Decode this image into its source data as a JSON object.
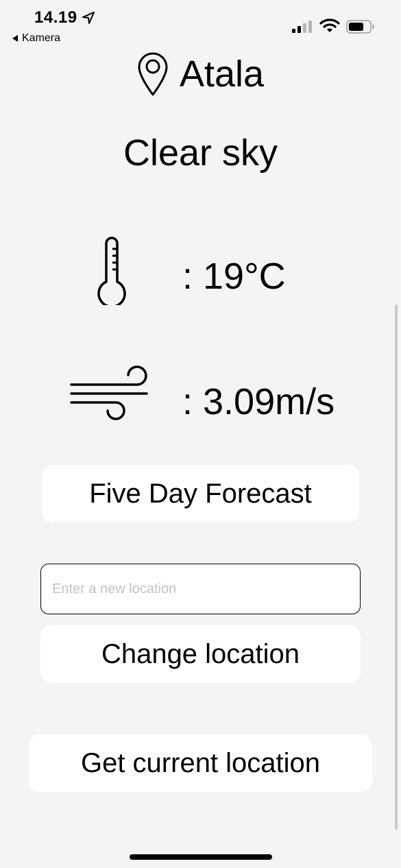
{
  "status_bar": {
    "time": "14.19",
    "back_label": "Kamera",
    "icons": [
      "location-arrow-icon",
      "cellular-signal-icon",
      "wifi-icon",
      "battery-icon"
    ]
  },
  "weather": {
    "city": "Atala",
    "condition": "Clear sky",
    "temperature": ": 19°C",
    "wind_speed": ": 3.09m/s",
    "icons": [
      "location-pin-icon",
      "thermometer-icon",
      "wind-icon"
    ]
  },
  "actions": {
    "forecast_label": "Five Day Forecast",
    "location_placeholder": "Enter a new location",
    "location_value": "",
    "change_location_label": "Change location",
    "current_location_label": "Get current location"
  }
}
